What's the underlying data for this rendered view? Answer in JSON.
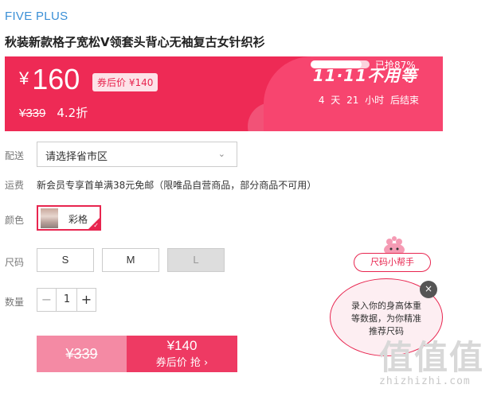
{
  "brand": "FIVE PLUS",
  "product_title": "秋装新款格子宽松V领套头背心无袖复古女针织衫",
  "price": {
    "currency": "¥",
    "current": "160",
    "coupon_tag": "券后价 ¥140",
    "original": "¥339",
    "discount": "4.2折"
  },
  "promo": {
    "title": "11·11不用等",
    "countdown": "4 天 21 小时 后结束",
    "progress_percent": 87,
    "progress_text": "已抢87%"
  },
  "colors": {
    "accent": "#ee2a55",
    "brand": "#3a8fd6"
  },
  "delivery": {
    "label": "配送",
    "placeholder": "请选择省市区",
    "chevron_icon": "chevron-down-icon"
  },
  "shipping": {
    "label": "运费",
    "text": "新会员专享首单满38元免邮（限唯品自营商品，部分商品不可用）"
  },
  "color_option": {
    "label": "颜色",
    "selected": "彩格",
    "check_icon": "checkmark-icon"
  },
  "size": {
    "label": "尺码",
    "options": [
      "S",
      "M",
      "L"
    ],
    "disabled": [
      "L"
    ]
  },
  "quantity": {
    "label": "数量",
    "minus": "−",
    "value": "1",
    "plus": "+"
  },
  "buy": {
    "original": "¥339",
    "price": "¥140",
    "cta": "券后价 抢 ›"
  },
  "size_helper": {
    "pill": "尺码小帮手",
    "bubble_text": "录入你的身高体重等数据，为你精准推荐尺码",
    "close": "×"
  },
  "watermark": {
    "logo": "值值值",
    "site": "zhizhizhi.com"
  }
}
